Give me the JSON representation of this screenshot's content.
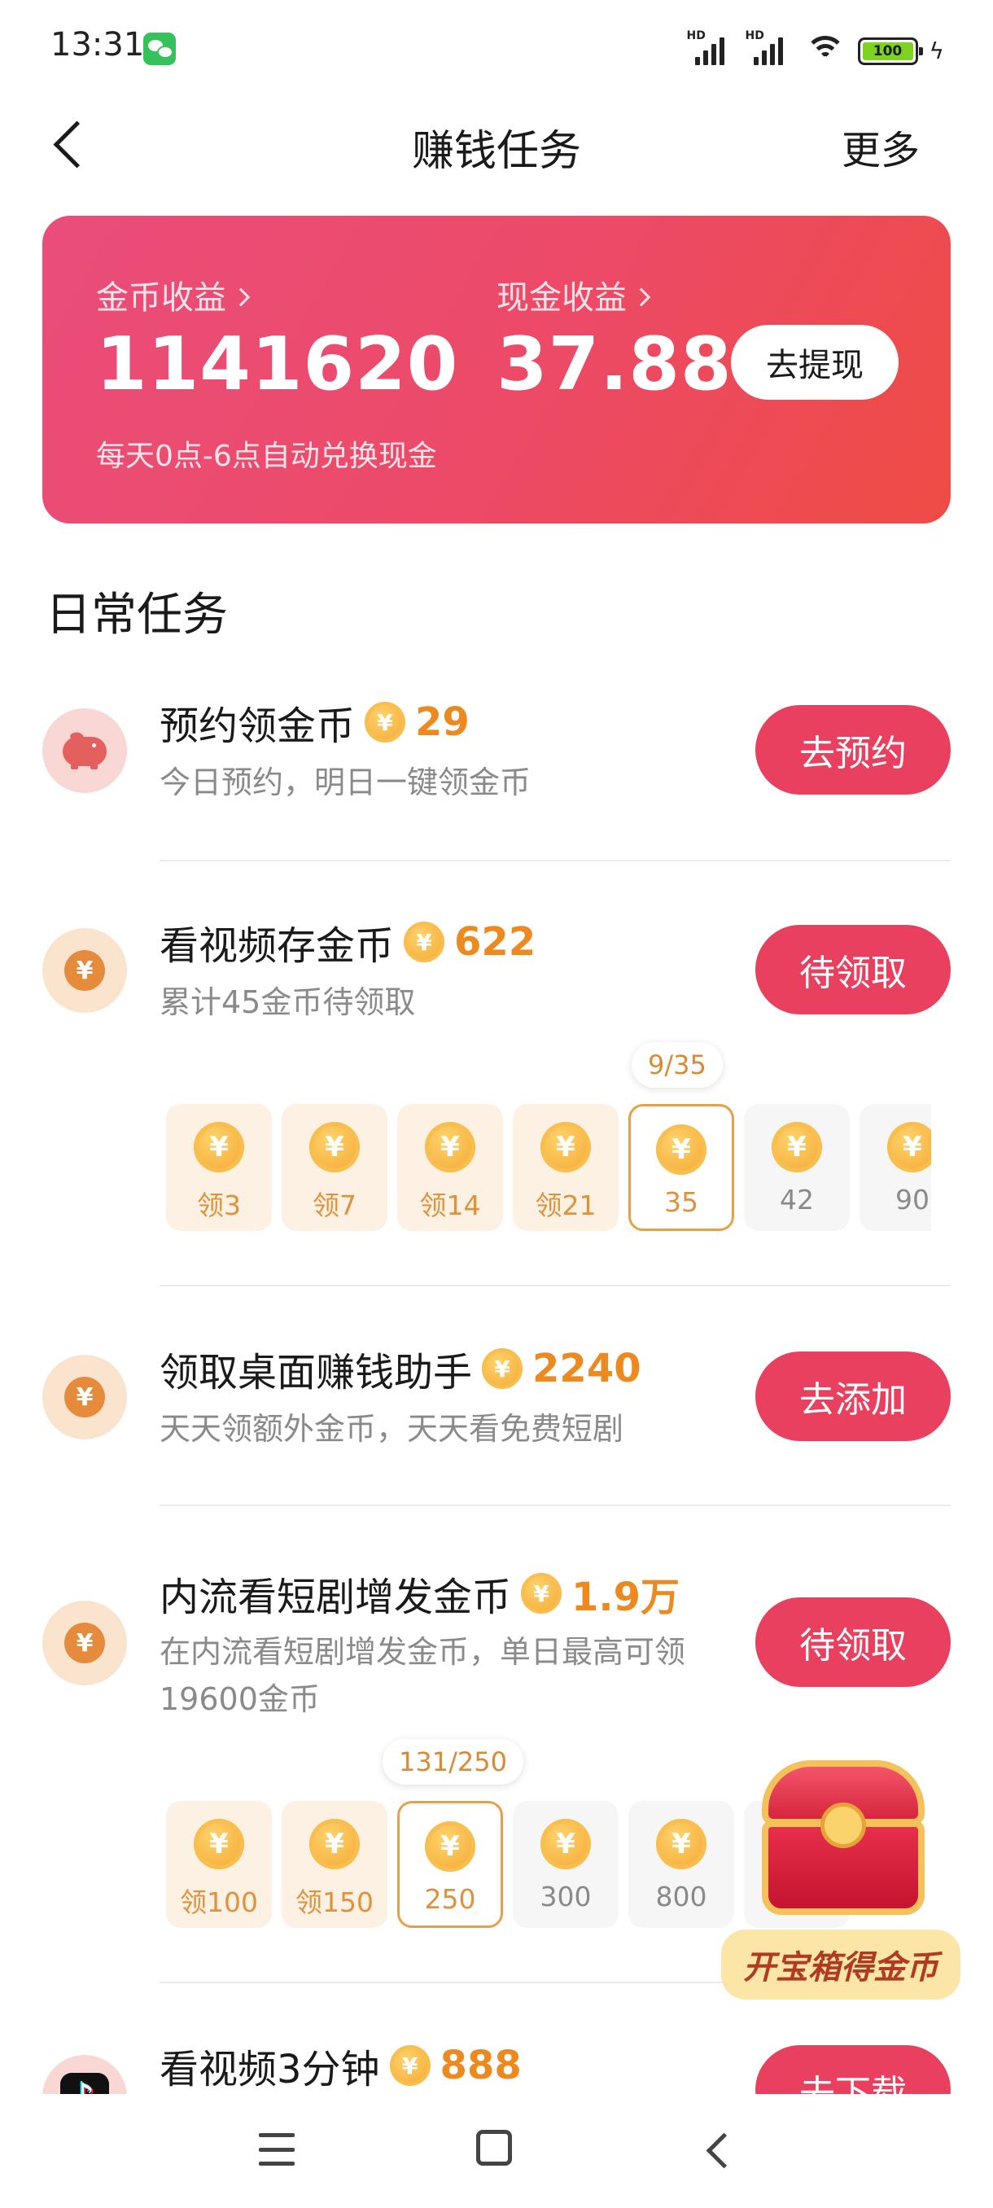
{
  "status_bar": {
    "time": "13:31",
    "hd_label_1": "HD",
    "hd_label_2": "HD",
    "battery_level": "100",
    "icons": [
      "wechat-icon",
      "signal-icon",
      "signal-icon",
      "wifi-icon",
      "battery-icon",
      "charging-icon"
    ]
  },
  "header": {
    "title": "赚钱任务",
    "more": "更多"
  },
  "earnings": {
    "coins_label": "金币收益",
    "coins_value": "1141620",
    "cash_label": "现金收益",
    "cash_value": "37.88",
    "withdraw_label": "去提现",
    "note": "每天0点-6点自动兑换现金"
  },
  "section_title": "日常任务",
  "coin_symbol": "¥",
  "tasks": [
    {
      "title": "预约领金币",
      "reward": "29",
      "desc": "今日预约，明日一键领金币",
      "button": "去预约"
    },
    {
      "title": "看视频存金币",
      "reward": "622",
      "desc": "累计45金币待领取",
      "button": "待领取",
      "progress": "9/35",
      "milestones": [
        "领3",
        "领7",
        "领14",
        "领21",
        "35",
        "42",
        "90"
      ]
    },
    {
      "title": "领取桌面赚钱助手",
      "reward": "2240",
      "desc": "天天领额外金币，天天看免费短剧",
      "button": "去添加"
    },
    {
      "title": "内流看短剧增发金币",
      "reward": "1.9万",
      "desc": "在内流看短剧增发金币，单日最高可领19600金币",
      "button": "待领取",
      "progress": "131/250",
      "milestones": [
        "领100",
        "领150",
        "250",
        "300",
        "800"
      ]
    },
    {
      "title": "看视频3分钟",
      "reward": "888",
      "button": "去下载"
    }
  ],
  "chest_label": "开宝箱得金币",
  "colors": {
    "accent": "#e8405e",
    "coin": "#f3a530",
    "reward_text": "#ec8a1f"
  }
}
